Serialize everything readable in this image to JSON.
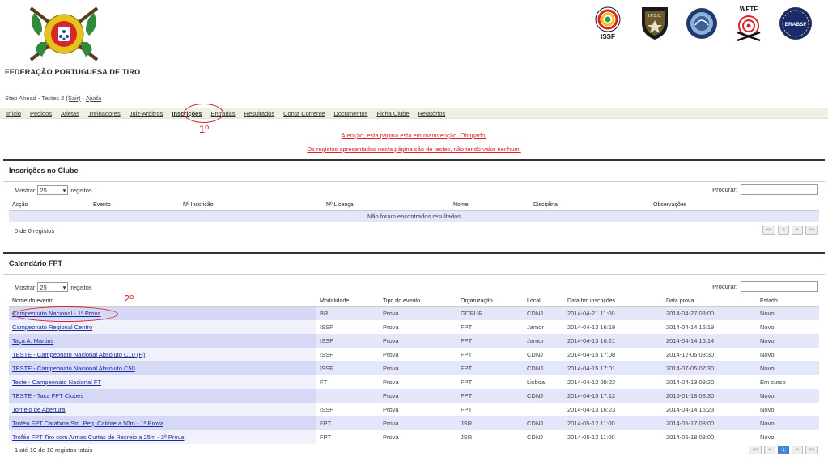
{
  "header": {
    "org_name": "FEDERAÇÃO PORTUGUESA DE TIRO",
    "logos": [
      {
        "name": "issf-logo",
        "label": "ISSF"
      },
      {
        "name": "ipsc-logo",
        "label": "I.P.S.C."
      },
      {
        "name": "round-seal-logo",
        "label": ""
      },
      {
        "name": "wftf-logo",
        "label": "WFTF"
      },
      {
        "name": "erabsf-logo",
        "label": "ERABSF"
      }
    ]
  },
  "userline": {
    "user": "Step Ahead - Testes 2",
    "logout": "(Sair)",
    "separator": "-",
    "help": "Ajuda"
  },
  "nav": [
    {
      "label": "Início"
    },
    {
      "label": "Pedidos"
    },
    {
      "label": "Atletas"
    },
    {
      "label": "Treinadores"
    },
    {
      "label": "Juiz-Arbitros"
    },
    {
      "label": "Inscrições"
    },
    {
      "label": "Entradas"
    },
    {
      "label": "Resultados"
    },
    {
      "label": "Conta Corrente"
    },
    {
      "label": "Documentos"
    },
    {
      "label": "Ficha Clube"
    },
    {
      "label": "Relatórios"
    }
  ],
  "annotations": {
    "first": "1º",
    "second": "2º"
  },
  "warnings": {
    "maintenance": "Atenção, esta página está em manutenção. Obrigado.",
    "test_records": "Os registos apresentados nesta página são de testes, não tendo valor nenhum."
  },
  "inscricoes": {
    "title": "Inscrições no Clube",
    "show_label": "Mostrar",
    "page_size": "25",
    "records_label": "registos",
    "search_label": "Procurar:",
    "columns": [
      "Acção",
      "Evento",
      "Nº Inscrição",
      "Nº Licença",
      "Nome",
      "Disciplina",
      "Observações"
    ],
    "empty": "Não foram encontrados resultados",
    "info": "0 de 0 registos",
    "pager": [
      "<<",
      "<",
      ">",
      ">>"
    ]
  },
  "calendario": {
    "title": "Calendário FPT",
    "show_label": "Mostrar",
    "page_size": "25",
    "records_label": "registos",
    "search_label": "Procurar:",
    "columns": [
      "Nome do evento",
      "Modalidade",
      "Tipo do evento",
      "Organização",
      "Local",
      "Data fim inscrições",
      "Data prova",
      "Estado"
    ],
    "rows": [
      [
        "Campeonato Nacional - 1ª Prova",
        "BR",
        "Prova",
        "GDRUR",
        "CDNJ",
        "2014-04-21 11:00",
        "2014-04-27 08:00",
        "Novo"
      ],
      [
        "Campeonato Regional Centro",
        "ISSF",
        "Prova",
        "FPT",
        "Jamor",
        "2014-04-13 16:19",
        "2014-04-14 16:19",
        "Novo"
      ],
      [
        "Taça A. Martins",
        "ISSF",
        "Prova",
        "FPT",
        "Jamor",
        "2014-04-13 16:21",
        "2014-04-14 16:14",
        "Novo"
      ],
      [
        "TESTE - Campeonato Nacional Absoluto C10 (H)",
        "ISSF",
        "Prova",
        "FPT",
        "CDNJ",
        "2014-04-15 17:08",
        "2014-12-06 08:30",
        "Novo"
      ],
      [
        "TESTE - Campeonato Nacional Absoluto C50",
        "ISSF",
        "Prova",
        "FPT",
        "CDNJ",
        "2014-04-15 17:01",
        "2014-07-05 07:30",
        "Novo"
      ],
      [
        "Teste - Campeonato Nacional FT",
        "FT",
        "Prova",
        "FPT",
        "Lisboa",
        "2014-04-12 09:22",
        "2014-04-13 09:20",
        "Em curso"
      ],
      [
        "TESTE - Taça FPT Clubes",
        "",
        "Prova",
        "FPT",
        "CDNJ",
        "2014-04-15 17:12",
        "2015-01-18 08:30",
        "Novo"
      ],
      [
        "Torneio de Abertura",
        "ISSF",
        "Prova",
        "FPT",
        "",
        "2014-04-13 16:23",
        "2014-04-14 16:23",
        "Novo"
      ],
      [
        "Troféu FPT Carabina Std. Peq. Calibre a 50m - 1ª Prova",
        "FPT",
        "Prova",
        "JSR",
        "CDNJ",
        "2014-05-12 11:00",
        "2014-05-17 08:00",
        "Novo"
      ],
      [
        "Troféu FPT Tiro com Armas Curtas de Recreio a 25m - 3ª Prova",
        "FPT",
        "Prova",
        "JSR",
        "CDNJ",
        "2014-05-12 11:00",
        "2014-05-18 08:00",
        "Novo"
      ]
    ],
    "info": "1 até 10 de 10 registos totais",
    "pager": [
      "<<",
      "<",
      "1",
      ">",
      ">>"
    ]
  },
  "colors": {
    "accent_red": "#d9222a",
    "link_blue": "#1a2c9a",
    "row_tint": "#e4e6f9",
    "pager_current": "#4a86d8"
  }
}
